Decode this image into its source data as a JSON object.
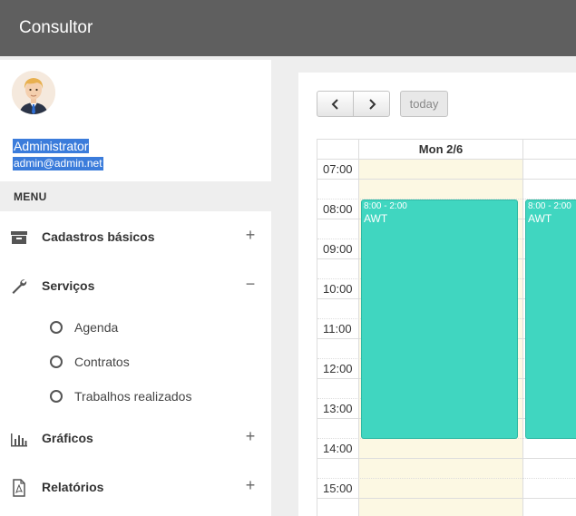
{
  "app": {
    "title": "Consultor"
  },
  "user": {
    "name": "Administrator",
    "email": "admin@admin.net"
  },
  "menu": {
    "header": "MENU",
    "items": [
      {
        "label": "Cadastros básicos",
        "toggle": "+"
      },
      {
        "label": "Serviços",
        "toggle": "−"
      },
      {
        "label": "Gráficos",
        "toggle": "+"
      },
      {
        "label": "Relatórios",
        "toggle": "+"
      }
    ],
    "subitems": [
      {
        "label": "Agenda"
      },
      {
        "label": "Contratos"
      },
      {
        "label": "Trabalhos realizados"
      }
    ]
  },
  "calendar": {
    "today_label": "today",
    "columns": [
      {
        "header": "Mon 2/6"
      },
      {
        "header": ""
      }
    ],
    "times": [
      "07:00",
      "08:00",
      "09:00",
      "10:00",
      "11:00",
      "12:00",
      "13:00",
      "14:00",
      "15:00"
    ],
    "events": [
      {
        "time": "8:00 - 2:00",
        "title": "AWT"
      },
      {
        "time": "8:00 - 2:00",
        "title": "AWT"
      }
    ]
  }
}
